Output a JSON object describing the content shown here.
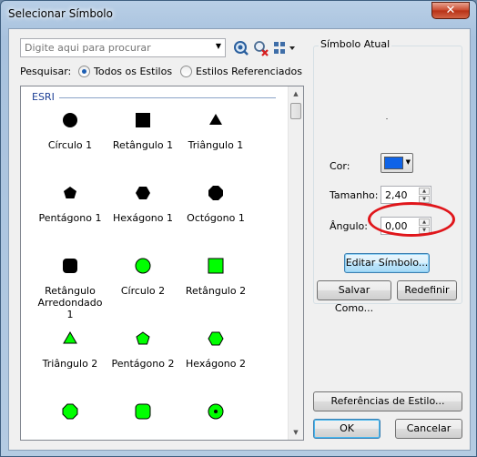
{
  "window": {
    "title": "Selecionar Símbolo",
    "close_glyph": "✕"
  },
  "search": {
    "placeholder": "Digite aqui para procurar",
    "value": ""
  },
  "toolbar": {
    "icons": [
      "search-icon",
      "clear-search-icon",
      "view-options-icon"
    ]
  },
  "search_scope": {
    "label": "Pesquisar:",
    "options": [
      {
        "label": "Todos os Estilos",
        "selected": true
      },
      {
        "label": "Estilos Referenciados",
        "selected": false
      }
    ]
  },
  "symbol_list": {
    "group_name": "ESRI",
    "items": [
      {
        "label": "Círculo 1",
        "shape": "circle",
        "color": "#000000"
      },
      {
        "label": "Retângulo 1",
        "shape": "square",
        "color": "#000000"
      },
      {
        "label": "Triângulo 1",
        "shape": "triangle",
        "color": "#000000"
      },
      {
        "label": "Pentágono 1",
        "shape": "pentagon",
        "color": "#000000"
      },
      {
        "label": "Hexágono 1",
        "shape": "hexagon",
        "color": "#000000"
      },
      {
        "label": "Octógono 1",
        "shape": "octagon",
        "color": "#000000"
      },
      {
        "label": "Retângulo Arredondado 1",
        "shape": "rounded-square",
        "color": "#000000"
      },
      {
        "label": "Círculo 2",
        "shape": "circle",
        "color": "#00ff00"
      },
      {
        "label": "Retângulo 2",
        "shape": "square",
        "color": "#00ff00"
      },
      {
        "label": "Triângulo 2",
        "shape": "triangle",
        "color": "#00ff00"
      },
      {
        "label": "Pentágono 2",
        "shape": "pentagon",
        "color": "#00ff00"
      },
      {
        "label": "Hexágono 2",
        "shape": "hexagon",
        "color": "#00ff00"
      },
      {
        "label": "",
        "shape": "octagon",
        "color": "#00ff00"
      },
      {
        "label": "",
        "shape": "rounded-square",
        "color": "#00ff00"
      },
      {
        "label": "",
        "shape": "circle-dot",
        "color": "#00ff00"
      }
    ]
  },
  "current_symbol": {
    "title": "Símbolo Atual",
    "color_label": "Cor:",
    "color_value": "#0f63e7",
    "size_label": "Tamanho:",
    "size_value": "2,40",
    "angle_label": "Ângulo:",
    "angle_value": "0,00",
    "edit_button": "Editar Símbolo...",
    "save_as_button": "Salvar Como...",
    "reset_button": "Redefinir"
  },
  "footer": {
    "style_refs_button": "Referências de Estilo...",
    "ok_button": "OK",
    "cancel_button": "Cancelar"
  },
  "annotation": {
    "highlight_color": "#e0161b"
  }
}
